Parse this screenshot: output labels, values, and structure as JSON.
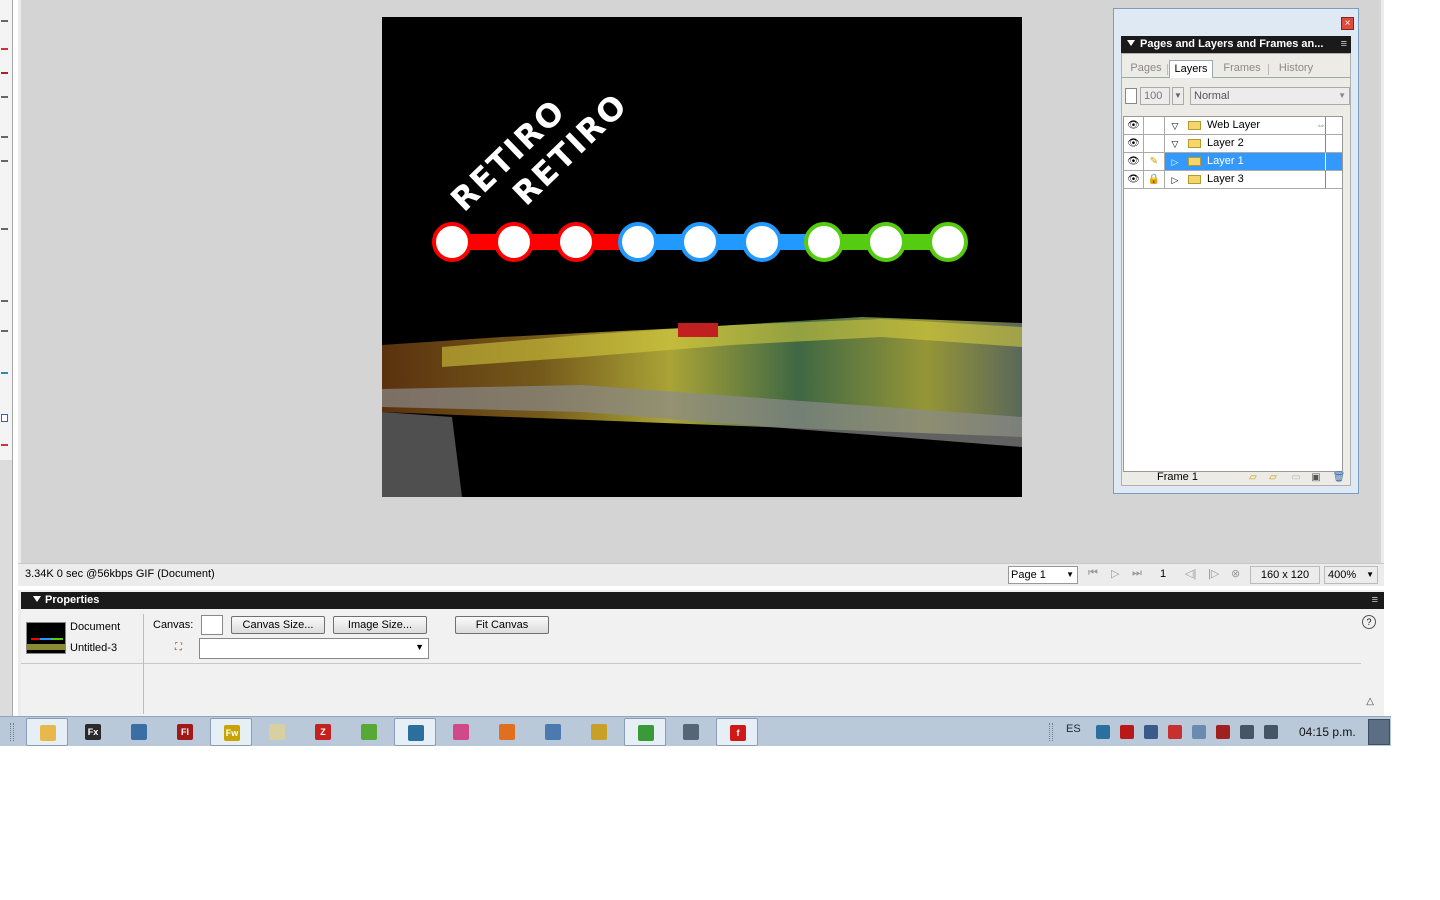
{
  "colors": {
    "workspace": "#d4d4d4",
    "selection": "#3399ff",
    "line_red": "#ff0000",
    "line_blue": "#2299ff",
    "line_green": "#55cc11"
  },
  "canvas_art": {
    "words": [
      "RETIRO",
      "RETIRO"
    ],
    "stations": [
      {
        "color": "red"
      },
      {
        "color": "red"
      },
      {
        "color": "red"
      },
      {
        "color": "blue"
      },
      {
        "color": "blue"
      },
      {
        "color": "blue"
      },
      {
        "color": "green"
      },
      {
        "color": "green"
      },
      {
        "color": "green"
      }
    ]
  },
  "layers_panel": {
    "title": "Pages and Layers and Frames an...",
    "tabs": [
      "Pages",
      "Layers",
      "Frames",
      "History"
    ],
    "active_tab": "Layers",
    "opacity": "100",
    "blend_mode": "Normal",
    "layers": [
      {
        "name": "Web Layer",
        "expanded": true,
        "locked": false,
        "editable": false,
        "selected": false
      },
      {
        "name": "Layer 2",
        "expanded": true,
        "locked": false,
        "editable": false,
        "selected": false
      },
      {
        "name": "Layer 1",
        "expanded": false,
        "locked": false,
        "editable": true,
        "selected": true
      },
      {
        "name": "Layer 3",
        "expanded": false,
        "locked": true,
        "editable": false,
        "selected": false
      }
    ],
    "frame_label": "Frame 1"
  },
  "statusbar": {
    "info": "3.34K  0 sec @56kbps  GIF (Document)",
    "page": "Page 1",
    "frame_number": "1",
    "size": "160 x 120",
    "zoom": "400%"
  },
  "properties": {
    "title": "Properties",
    "doc_type": "Document",
    "doc_name": "Untitled-3",
    "canvas_label": "Canvas:",
    "canvas_size_btn": "Canvas Size...",
    "image_size_btn": "Image Size...",
    "fit_canvas_btn": "Fit Canvas",
    "help_icon": "?"
  },
  "taskbar": {
    "language": "ES",
    "clock": "04:15 p.m.",
    "apps": [
      {
        "name": "explorer",
        "label": "",
        "color": "#e8b84a",
        "active": true
      },
      {
        "name": "flex",
        "label": "Fx",
        "color": "#2a2a2a",
        "active": false
      },
      {
        "name": "network-tool",
        "label": "",
        "color": "#3a6ea5",
        "active": false
      },
      {
        "name": "flash",
        "label": "Fl",
        "color": "#a01818",
        "active": false
      },
      {
        "name": "fireworks",
        "label": "Fw",
        "color": "#c8a400",
        "active": true
      },
      {
        "name": "notepad",
        "label": "",
        "color": "#d8d0a0",
        "active": false
      },
      {
        "name": "filezilla",
        "label": "Z",
        "color": "#c42020",
        "active": false
      },
      {
        "name": "messenger",
        "label": "",
        "color": "#58a838",
        "active": false
      },
      {
        "name": "skype-tool",
        "label": "",
        "color": "#2b6f9e",
        "active": true
      },
      {
        "name": "picasa",
        "label": "",
        "color": "#d04a8a",
        "active": false
      },
      {
        "name": "firefox",
        "label": "",
        "color": "#e07020",
        "active": false
      },
      {
        "name": "itunes",
        "label": "",
        "color": "#4a7ab0",
        "active": false
      },
      {
        "name": "winamp",
        "label": "",
        "color": "#c8a028",
        "active": false
      },
      {
        "name": "chrome",
        "label": "",
        "color": "#3a9a3a",
        "active": true
      },
      {
        "name": "calendar",
        "label": "",
        "color": "#556677",
        "active": false
      },
      {
        "name": "flash-player",
        "label": "f",
        "color": "#d01818",
        "active": true
      }
    ],
    "tray": [
      {
        "name": "network-icon",
        "color": "#2b6f9e"
      },
      {
        "name": "adobe-icon",
        "color": "#b81818"
      },
      {
        "name": "printer-icon",
        "color": "#3a5a8a"
      },
      {
        "name": "alert-icon",
        "color": "#c83030"
      },
      {
        "name": "mail-icon",
        "color": "#6a8ab0"
      },
      {
        "name": "usb-icon",
        "color": "#a02020"
      },
      {
        "name": "signal-icon",
        "color": "#445566"
      },
      {
        "name": "volume-icon",
        "color": "#445566"
      }
    ]
  }
}
